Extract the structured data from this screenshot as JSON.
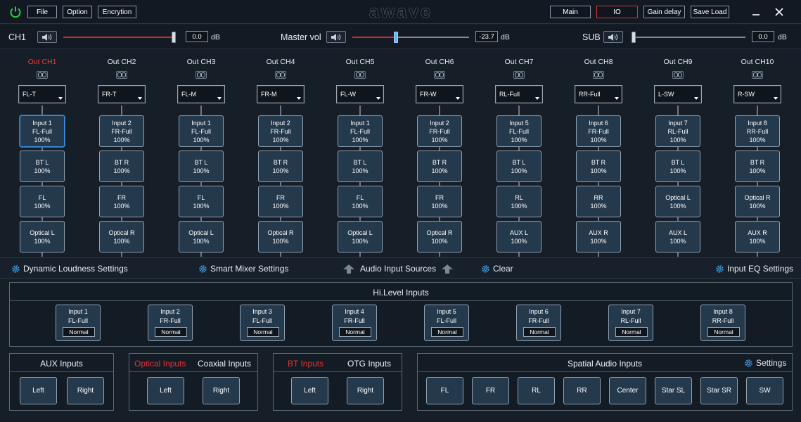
{
  "titlebar": {
    "logo": "awave",
    "menu": [
      "File",
      "Option",
      "Encrytion"
    ],
    "buttons": [
      "Main",
      "IO",
      "Gain delay",
      "Save Load"
    ],
    "active_button": "IO"
  },
  "volume": {
    "ch1": {
      "label": "CH1",
      "value": "0.0",
      "unit": "dB",
      "level": 1.0
    },
    "master": {
      "label": "Master vol",
      "value": "-23.7",
      "unit": "dB",
      "level": 0.37
    },
    "sub": {
      "label": "SUB",
      "value": "0.0",
      "unit": "dB",
      "level": 0.0
    }
  },
  "channels": [
    {
      "name": "Out CH1",
      "select": "FL-T",
      "inputs": [
        [
          "Input 1",
          "FL-Full",
          "100%"
        ],
        [
          "BT L",
          "100%"
        ],
        [
          "FL",
          "100%"
        ],
        [
          "Optical L",
          "100%"
        ]
      ]
    },
    {
      "name": "Out CH2",
      "select": "FR-T",
      "inputs": [
        [
          "Input 2",
          "FR-Full",
          "100%"
        ],
        [
          "BT R",
          "100%"
        ],
        [
          "FR",
          "100%"
        ],
        [
          "Optical R",
          "100%"
        ]
      ]
    },
    {
      "name": "Out CH3",
      "select": "FL-M",
      "inputs": [
        [
          "Input 1",
          "FL-Full",
          "100%"
        ],
        [
          "BT L",
          "100%"
        ],
        [
          "FL",
          "100%"
        ],
        [
          "Optical L",
          "100%"
        ]
      ]
    },
    {
      "name": "Out CH4",
      "select": "FR-M",
      "inputs": [
        [
          "Input 2",
          "FR-Full",
          "100%"
        ],
        [
          "BT R",
          "100%"
        ],
        [
          "FR",
          "100%"
        ],
        [
          "Optical R",
          "100%"
        ]
      ]
    },
    {
      "name": "Out CH5",
      "select": "FL-W",
      "inputs": [
        [
          "Input 1",
          "FL-Full",
          "100%"
        ],
        [
          "BT L",
          "100%"
        ],
        [
          "FL",
          "100%"
        ],
        [
          "Optical L",
          "100%"
        ]
      ]
    },
    {
      "name": "Out CH6",
      "select": "FR-W",
      "inputs": [
        [
          "Input 2",
          "FR-Full",
          "100%"
        ],
        [
          "BT R",
          "100%"
        ],
        [
          "FR",
          "100%"
        ],
        [
          "Optical R",
          "100%"
        ]
      ]
    },
    {
      "name": "Out CH7",
      "select": "RL-Full",
      "inputs": [
        [
          "Input 5",
          "FL-Full",
          "100%"
        ],
        [
          "BT L",
          "100%"
        ],
        [
          "RL",
          "100%"
        ],
        [
          "AUX L",
          "100%"
        ]
      ]
    },
    {
      "name": "Out CH8",
      "select": "RR-Full",
      "inputs": [
        [
          "Input 6",
          "FR-Full",
          "100%"
        ],
        [
          "BT R",
          "100%"
        ],
        [
          "RR",
          "100%"
        ],
        [
          "AUX R",
          "100%"
        ]
      ]
    },
    {
      "name": "Out CH9",
      "select": "L-SW",
      "inputs": [
        [
          "Input 7",
          "RL-Full",
          "100%"
        ],
        [
          "BT L",
          "100%"
        ],
        [
          "Optical L",
          "100%"
        ],
        [
          "AUX L",
          "100%"
        ]
      ]
    },
    {
      "name": "Out CH10",
      "select": "R-SW",
      "inputs": [
        [
          "Input 8",
          "RR-Full",
          "100%"
        ],
        [
          "BT R",
          "100%"
        ],
        [
          "Optical R",
          "100%"
        ],
        [
          "AUX R",
          "100%"
        ]
      ]
    }
  ],
  "settings_bar": {
    "dynamic": "Dynamic Loudness Settings",
    "smart": "Smart Mixer Settings",
    "sources": "Audio Input Sources",
    "clear": "Clear",
    "input_eq": "Input EQ Settings"
  },
  "hilevel": {
    "title": "Hi.Level Inputs",
    "inputs": [
      [
        "Input 1",
        "FL-Full",
        "Normal"
      ],
      [
        "Input 2",
        "FR-Full",
        "Normal"
      ],
      [
        "Input 3",
        "FL-Full",
        "Normal"
      ],
      [
        "Input 4",
        "FR-Full",
        "Normal"
      ],
      [
        "Input 5",
        "FL-Full",
        "Normal"
      ],
      [
        "Input 6",
        "FR-Full",
        "Normal"
      ],
      [
        "Input 7",
        "RL-Full",
        "Normal"
      ],
      [
        "Input 8",
        "RR-Full",
        "Normal"
      ]
    ]
  },
  "aux": {
    "title": "AUX Inputs",
    "buttons": [
      "Left",
      "Right"
    ]
  },
  "optical": {
    "tab_active": "Optical Inputs",
    "tab": "Coaxial Inputs",
    "buttons": [
      "Left",
      "Right"
    ]
  },
  "bt": {
    "tab_active": "BT Inputs",
    "tab": "OTG Inputs",
    "buttons": [
      "Left",
      "Right"
    ]
  },
  "spatial": {
    "title": "Spatial Audio Inputs",
    "settings": "Settings",
    "buttons": [
      "FL",
      "FR",
      "RL",
      "RR",
      "Center",
      "Star SL",
      "Star SR",
      "SW"
    ]
  }
}
